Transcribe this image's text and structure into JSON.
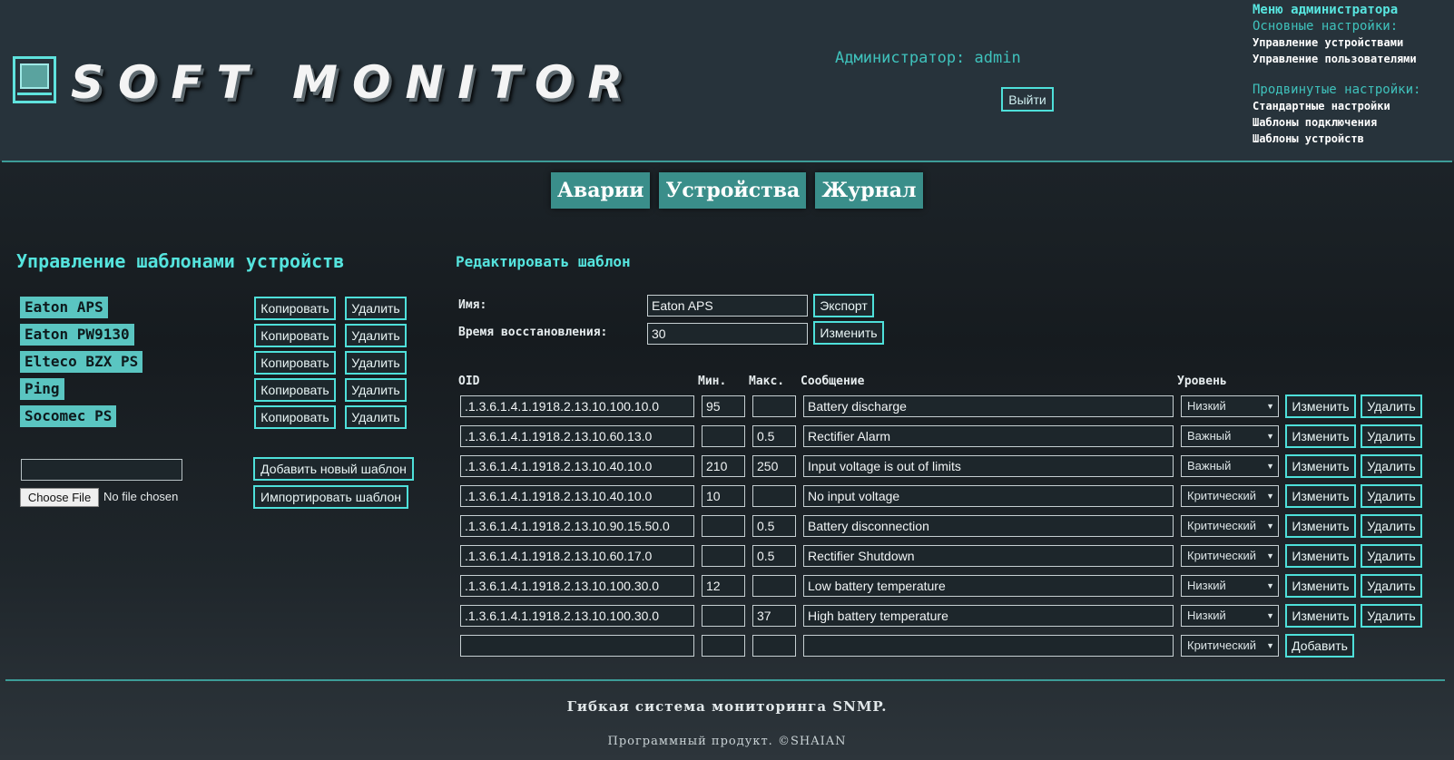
{
  "header": {
    "logo_text": "SOFT MONITOR",
    "admin_label": "Администратор: admin",
    "logout": "Выйти"
  },
  "admin_menu": {
    "title": "Меню администратора",
    "basic_section": "Основные настройки:",
    "basic_items": [
      "Управление устройствами",
      "Управление пользователями"
    ],
    "advanced_section": "Продвинутые настройки:",
    "advanced_items": [
      "Стандартные настройки",
      "Шаблоны подключения",
      "Шаблоны устройств"
    ]
  },
  "tabs": [
    "Аварии",
    "Устройства",
    "Журнал"
  ],
  "templates": {
    "title": "Управление шаблонами устройств",
    "copy_label": "Копировать",
    "delete_label": "Удалить",
    "items": [
      "Eaton APS",
      "Eaton PW9130",
      "Elteco BZX PS",
      "Ping",
      "Socomec PS"
    ],
    "new_template_value": "",
    "choose_file": "Choose File",
    "no_file": "No file chosen",
    "add_new": "Добавить новый шаблон",
    "import": "Импортировать шаблон"
  },
  "editor": {
    "title": "Редактировать шаблон",
    "name_label": "Имя:",
    "name_value": "Eaton APS",
    "export": "Экспорт",
    "recovery_label": "Время восстановления:",
    "recovery_value": "30",
    "change": "Изменить",
    "columns": {
      "oid": "OID",
      "min": "Мин.",
      "max": "Макс.",
      "message": "Сообщение",
      "level": "Уровень"
    },
    "row_change": "Изменить",
    "row_delete": "Удалить",
    "add": "Добавить",
    "rows": [
      {
        "oid": ".1.3.6.1.4.1.1918.2.13.10.100.10.0",
        "min": "95",
        "max": "",
        "message": "Battery discharge",
        "level": "Низкий"
      },
      {
        "oid": ".1.3.6.1.4.1.1918.2.13.10.60.13.0",
        "min": "",
        "max": "0.5",
        "message": "Rectifier Alarm",
        "level": "Важный"
      },
      {
        "oid": ".1.3.6.1.4.1.1918.2.13.10.40.10.0",
        "min": "210",
        "max": "250",
        "message": "Input voltage is out of limits",
        "level": "Важный"
      },
      {
        "oid": ".1.3.6.1.4.1.1918.2.13.10.40.10.0",
        "min": "10",
        "max": "",
        "message": "No input voltage",
        "level": "Критический"
      },
      {
        "oid": ".1.3.6.1.4.1.1918.2.13.10.90.15.50.0",
        "min": "",
        "max": "0.5",
        "message": "Battery disconnection",
        "level": "Критический"
      },
      {
        "oid": ".1.3.6.1.4.1.1918.2.13.10.60.17.0",
        "min": "",
        "max": "0.5",
        "message": "Rectifier Shutdown",
        "level": "Критический"
      },
      {
        "oid": ".1.3.6.1.4.1.1918.2.13.10.100.30.0",
        "min": "12",
        "max": "",
        "message": "Low battery temperature",
        "level": "Низкий"
      },
      {
        "oid": ".1.3.6.1.4.1.1918.2.13.10.100.30.0",
        "min": "",
        "max": "37",
        "message": "High battery temperature",
        "level": "Низкий"
      }
    ],
    "new_row": {
      "oid": "",
      "min": "",
      "max": "",
      "message": "",
      "level": "Критический"
    }
  },
  "footer": {
    "line1": "Гибкая система мониторинга SNMP.",
    "line2": "Программный продукт. ©SHAIAN"
  },
  "colors": {
    "accent": "#4ee0da",
    "tab_bg": "#3a8e8a",
    "template_chip": "#5ac5c1"
  }
}
